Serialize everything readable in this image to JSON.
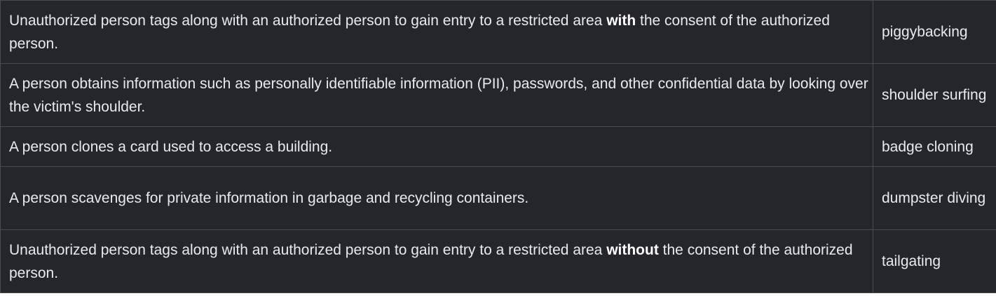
{
  "rows": [
    {
      "description_before": "Unauthorized person tags along with an authorized person to gain entry to a restricted area ",
      "description_emphasis": "with",
      "description_after": " the consent of the authorized person.",
      "term": "piggybacking"
    },
    {
      "description_before": "A person obtains information such as personally identifiable information (PII), passwords, and other confidential data by looking over the victim's shoulder.",
      "description_emphasis": "",
      "description_after": "",
      "term": "shoulder surfing"
    },
    {
      "description_before": "A person clones a card used to access a building.",
      "description_emphasis": "",
      "description_after": "",
      "term": "badge cloning"
    },
    {
      "description_before": "A person scavenges for private information in garbage and recycling containers.",
      "description_emphasis": "",
      "description_after": "",
      "term": "dumpster diving"
    },
    {
      "description_before": "Unauthorized person tags along with an authorized person to gain entry to a restricted area ",
      "description_emphasis": "without",
      "description_after": " the consent of the authorized person.",
      "term": "tailgating"
    }
  ]
}
